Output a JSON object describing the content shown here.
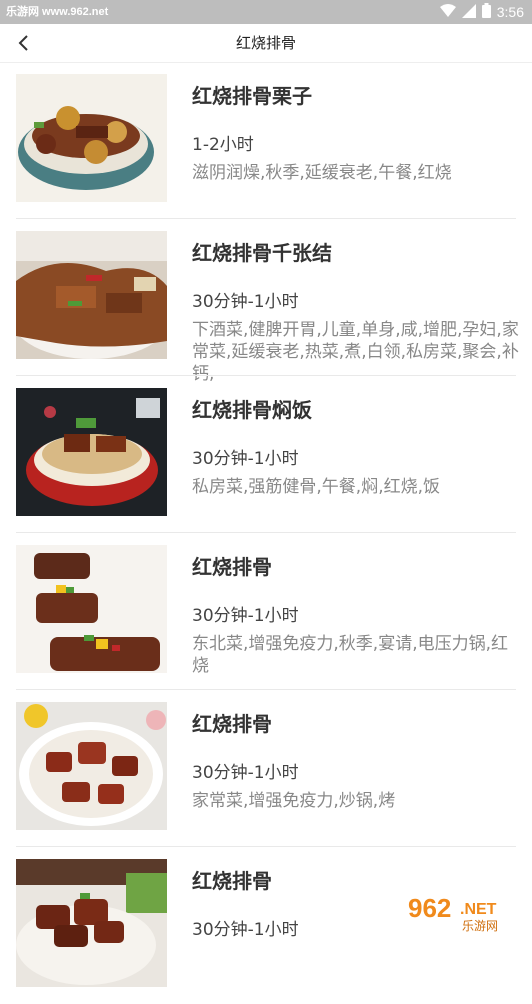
{
  "status_bar": {
    "source": "乐游网 www.962.net",
    "time": "3:56"
  },
  "header": {
    "title": "红烧排骨",
    "back_icon": "chevron-left-icon"
  },
  "recipes": [
    {
      "name": "红烧排骨栗子",
      "time": "1-2小时",
      "tags": "滋阴润燥,秋季,延缓衰老,午餐,红烧"
    },
    {
      "name": "红烧排骨千张结",
      "time": "30分钟-1小时",
      "tags": "下酒菜,健脾开胃,儿童,单身,咸,增肥,孕妇,家常菜,延缓衰老,热菜,煮,白领,私房菜,聚会,补钙,"
    },
    {
      "name": "红烧排骨焖饭",
      "time": "30分钟-1小时",
      "tags": "私房菜,强筋健骨,午餐,焖,红烧,饭"
    },
    {
      "name": "红烧排骨",
      "time": "30分钟-1小时",
      "tags": "东北菜,增强免疫力,秋季,宴请,电压力锅,红烧"
    },
    {
      "name": "红烧排骨",
      "time": "30分钟-1小时",
      "tags": "家常菜,增强免疫力,炒锅,烤"
    },
    {
      "name": "红烧排骨",
      "time": "30分钟-1小时",
      "tags": ""
    }
  ],
  "watermark": {
    "text1": "962",
    "text2": ".NET",
    "text3": "乐游网"
  }
}
